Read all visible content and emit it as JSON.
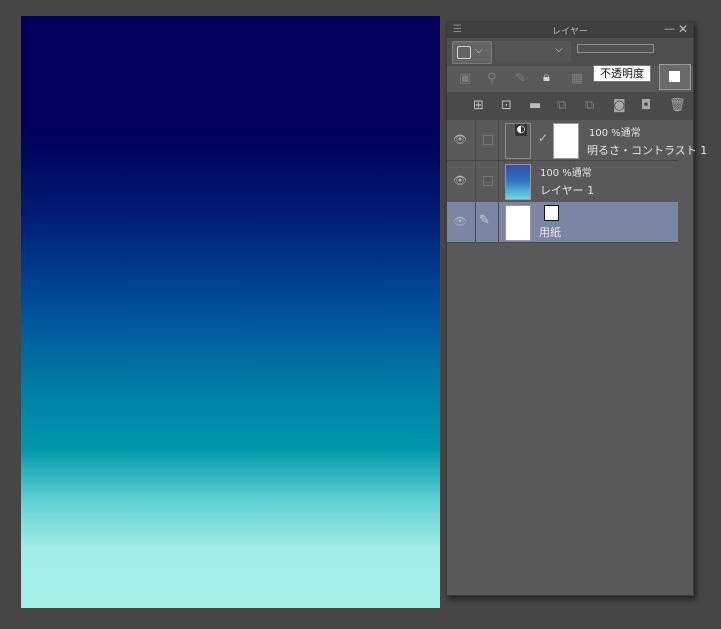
{
  "panel": {
    "title": "レイヤー",
    "menu_icon": "hamburger-icon",
    "minimize_icon": "minimize-icon",
    "close_icon": "close-icon",
    "tooltip": "不透明度",
    "main_color": "#ffffff"
  },
  "toolbar_row1": {
    "blend_chevron": "⌵",
    "mode_chevron": "⌵"
  },
  "toolbar_row2": {
    "icons": [
      "clip-icon",
      "reference-icon",
      "draft-icon",
      "lock-icon",
      "lock-transparent-icon"
    ]
  },
  "toolbar_row3": {
    "icons": [
      "new-raster-layer-icon",
      "new-vector-layer-icon",
      "new-folder-icon",
      "transfer-down-icon",
      "combine-down-icon",
      "mask-icon",
      "apply-mask-icon",
      "delete-icon"
    ]
  },
  "layers": [
    {
      "opacity_mode": "100 %通常",
      "name": "明るさ・コントラスト 1",
      "type": "adjustment"
    },
    {
      "opacity_mode": "100 %通常",
      "name": "レイヤー 1",
      "type": "gradient"
    },
    {
      "name": "用紙",
      "type": "paper",
      "selected": true
    }
  ],
  "canvas": {
    "gradient_colors": [
      "#00005a",
      "#001a72",
      "#004a98",
      "#007aa5",
      "#0097ac",
      "#a5f0e8"
    ]
  }
}
